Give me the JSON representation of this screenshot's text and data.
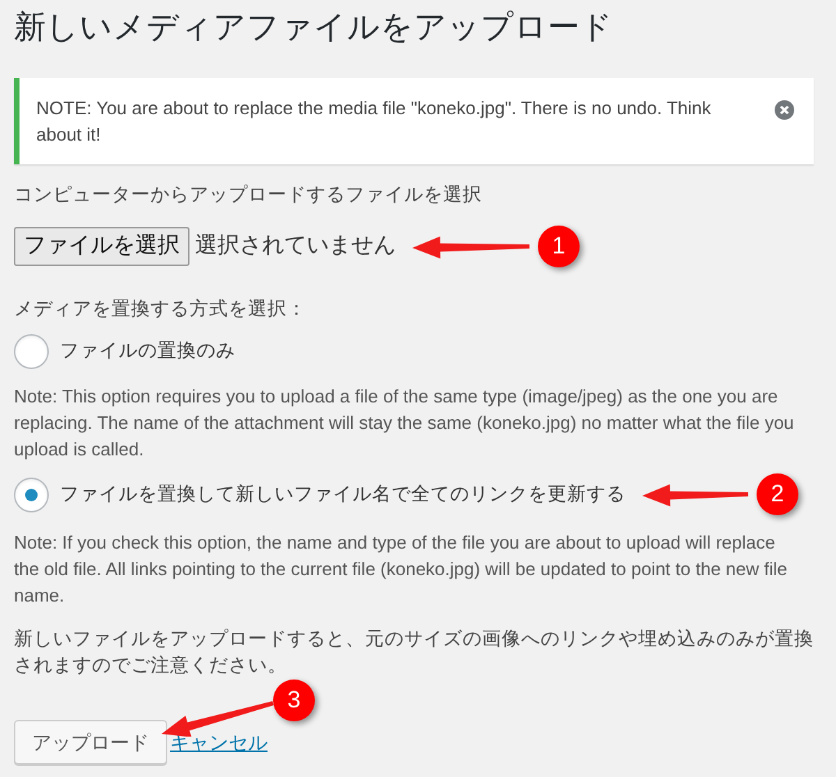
{
  "title": "新しいメディアファイルをアップロード",
  "notice": {
    "text": "NOTE: You are about to replace the media file \"koneko.jpg\". There is no undo. Think about it!"
  },
  "file_section": {
    "label": "コンピューターからアップロードするファイルを選択",
    "button": "ファイルを選択",
    "status": "選択されていません"
  },
  "method": {
    "label": "メディアを置換する方式を選択：",
    "options": [
      {
        "label": "ファイルの置換のみ",
        "selected": false,
        "note": "Note: This option requires you to upload a file of the same type (image/jpeg) as the one you are replacing. The name of the attachment will stay the same (koneko.jpg) no matter what the file you upload is called."
      },
      {
        "label": "ファイルを置換して新しいファイル名で全てのリンクを更新する",
        "selected": true,
        "note": "Note: If you check this option, the name and type of the file you are about to upload will replace the old file. All links pointing to the current file (koneko.jpg) will be updated to point to the new file name."
      }
    ]
  },
  "warning": "新しいファイルをアップロードすると、元のサイズの画像へのリンクや埋め込みのみが置換されますのでご注意ください。",
  "actions": {
    "upload": "アップロード",
    "cancel": "キャンセル"
  },
  "annotations": [
    {
      "number": "1"
    },
    {
      "number": "2"
    },
    {
      "number": "3"
    }
  ]
}
